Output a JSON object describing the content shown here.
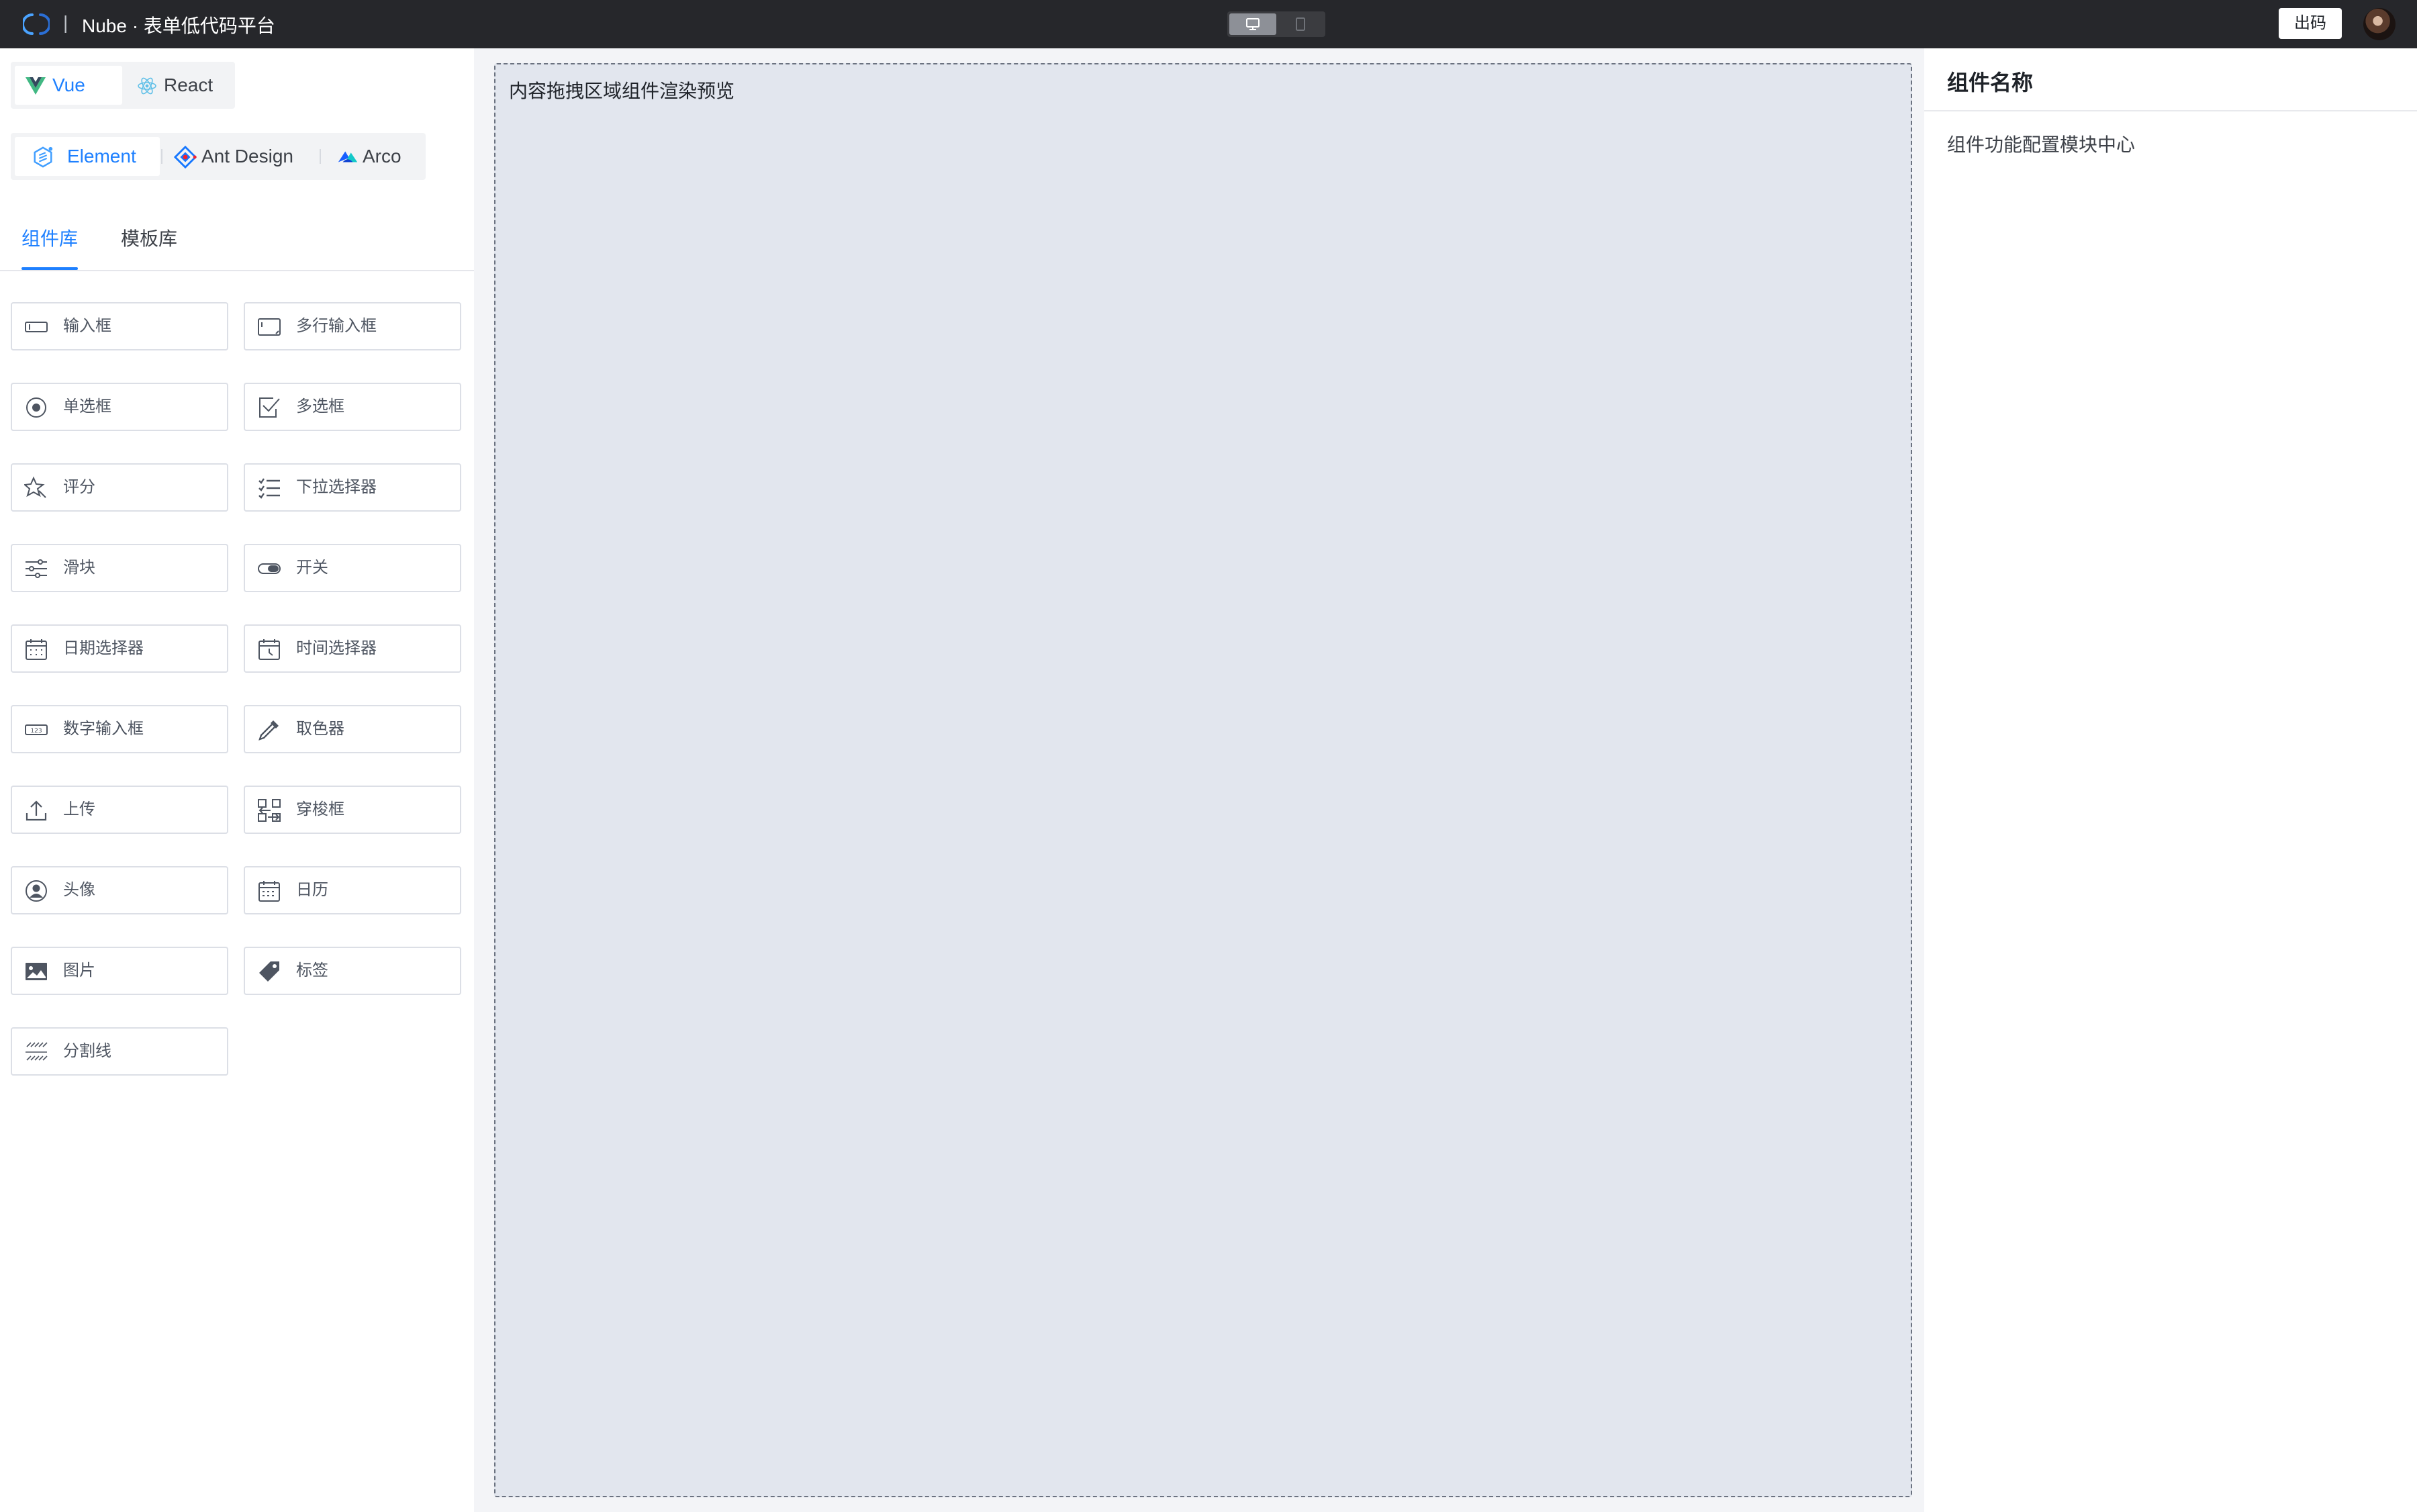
{
  "header": {
    "app_title": "Nube · 表单低代码平台",
    "separator": "|",
    "device_modes": [
      "desktop-icon",
      "mobile-icon"
    ],
    "export_label": "出码"
  },
  "frameworks": [
    {
      "label": "Vue",
      "icon": "vue-logo-icon",
      "active": true
    },
    {
      "label": "React",
      "icon": "react-logo-icon",
      "active": false
    }
  ],
  "ui_libraries": [
    {
      "label": "Element",
      "icon": "element-logo-icon",
      "active": true
    },
    {
      "label": "Ant Design",
      "icon": "ant-design-logo-icon",
      "active": false
    },
    {
      "label": "Arco",
      "icon": "arco-logo-icon",
      "active": false
    }
  ],
  "library_tabs": {
    "components": "组件库",
    "templates": "模板库",
    "active": "components"
  },
  "components": [
    {
      "label": "输入框",
      "icon": "input-icon"
    },
    {
      "label": "多行输入框",
      "icon": "textarea-icon"
    },
    {
      "label": "单选框",
      "icon": "radio-icon"
    },
    {
      "label": "多选框",
      "icon": "checkbox-icon"
    },
    {
      "label": "评分",
      "icon": "rate-icon"
    },
    {
      "label": "下拉选择器",
      "icon": "select-icon"
    },
    {
      "label": "滑块",
      "icon": "slider-icon"
    },
    {
      "label": "开关",
      "icon": "switch-icon"
    },
    {
      "label": "日期选择器",
      "icon": "date-picker-icon"
    },
    {
      "label": "时间选择器",
      "icon": "time-picker-icon"
    },
    {
      "label": "数字输入框",
      "icon": "number-input-icon"
    },
    {
      "label": "取色器",
      "icon": "color-picker-icon"
    },
    {
      "label": "上传",
      "icon": "upload-icon"
    },
    {
      "label": "穿梭框",
      "icon": "transfer-icon"
    },
    {
      "label": "头像",
      "icon": "avatar-icon"
    },
    {
      "label": "日历",
      "icon": "calendar-icon"
    },
    {
      "label": "图片",
      "icon": "image-icon"
    },
    {
      "label": "标签",
      "icon": "tag-icon"
    },
    {
      "label": "分割线",
      "icon": "divider-icon"
    }
  ],
  "canvas": {
    "placeholder": "内容拖拽区域组件渲染预览"
  },
  "config_panel": {
    "title": "组件名称",
    "description": "组件功能配置模块中心"
  },
  "colors": {
    "accent": "#1e80ff",
    "topbar": "#26272b",
    "canvas_bg": "#e2e6ee"
  }
}
